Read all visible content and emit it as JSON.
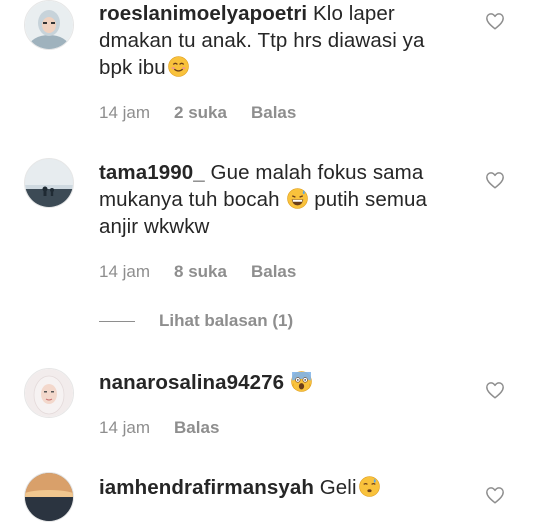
{
  "comments": [
    {
      "username": "roeslanimoelyapoetri",
      "text": " Klo laper dmakan tu anak. Ttp hrs diawasi ya bpk ibu",
      "emoji": "smiling-face-emoji",
      "time": "14 jam",
      "likes": "2 suka",
      "reply": "Balas"
    },
    {
      "username": "tama1990_",
      "text_before": " Gue malah fokus sama mukanya tuh bocah ",
      "emoji": "grinning-sweat-emoji",
      "text_after": " putih semua anjir wkwkw",
      "time": "14 jam",
      "likes": "8 suka",
      "reply": "Balas",
      "view_replies": "Lihat balasan (1)"
    },
    {
      "username": "nanarosalina94276",
      "emoji": "screaming-face-emoji",
      "time": "14 jam",
      "reply": "Balas"
    },
    {
      "username": "iamhendrafirmansyah",
      "text": " Geli",
      "emoji": "anxious-sweat-emoji"
    }
  ],
  "colors": {
    "text": "#262626",
    "meta": "#8e8e8e",
    "heart": "#8e8e8e"
  }
}
